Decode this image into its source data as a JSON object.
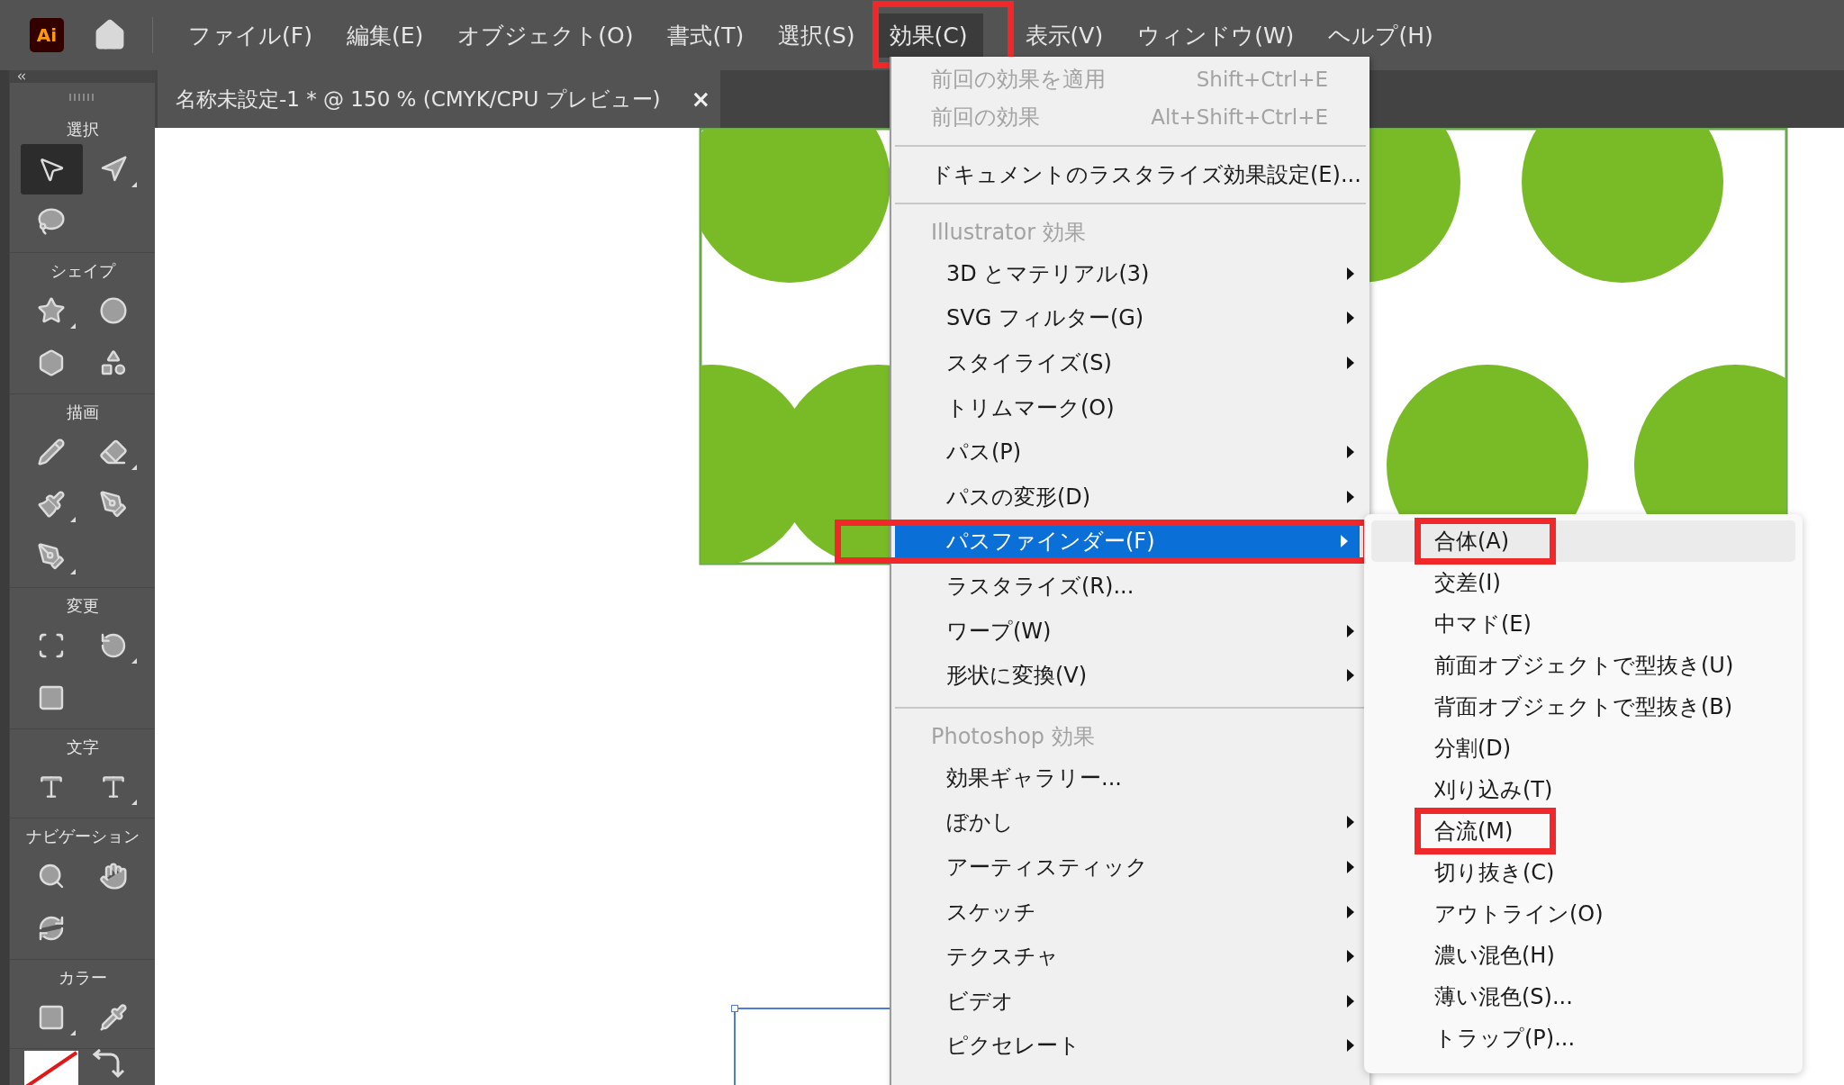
{
  "app": {
    "logo": "Ai"
  },
  "menu_bar": [
    {
      "label": "ファイル(F)",
      "selected": false,
      "marked": false
    },
    {
      "label": "編集(E)",
      "selected": false,
      "marked": false
    },
    {
      "label": "オブジェクト(O)",
      "selected": false,
      "marked": false
    },
    {
      "label": "書式(T)",
      "selected": false,
      "marked": false
    },
    {
      "label": "選択(S)",
      "selected": false,
      "marked": false
    },
    {
      "label": "効果(C)",
      "selected": true,
      "marked": true
    },
    {
      "label": "表示(V)",
      "selected": false,
      "marked": false
    },
    {
      "label": "ウィンドウ(W)",
      "selected": false,
      "marked": false
    },
    {
      "label": "ヘルプ(H)",
      "selected": false,
      "marked": false
    }
  ],
  "document_tab": {
    "title": "名称未設定-1 * @ 150 % (CMYK/CPU プレビュー)",
    "close": "×"
  },
  "toolbar": {
    "sections": [
      {
        "label": "選択",
        "tools": [
          {
            "selected": true,
            "flyout": false
          },
          {
            "selected": false,
            "flyout": true
          },
          {
            "selected": false,
            "flyout": false
          }
        ]
      },
      {
        "label": "シェイプ",
        "tools": [
          {
            "selected": false,
            "flyout": true
          },
          {
            "selected": false,
            "flyout": false
          },
          {
            "selected": false,
            "flyout": false
          },
          {
            "selected": false,
            "flyout": false
          }
        ]
      },
      {
        "label": "描画",
        "tools": [
          {
            "selected": false,
            "flyout": false
          },
          {
            "selected": false,
            "flyout": true
          },
          {
            "selected": false,
            "flyout": true
          },
          {
            "selected": false,
            "flyout": false
          },
          {
            "selected": false,
            "flyout": true
          }
        ]
      },
      {
        "label": "変更",
        "tools": [
          {
            "selected": false,
            "flyout": false
          },
          {
            "selected": false,
            "flyout": true
          },
          {
            "selected": false,
            "flyout": false
          }
        ]
      },
      {
        "label": "文字",
        "tools": [
          {
            "selected": false,
            "flyout": false
          },
          {
            "selected": false,
            "flyout": true
          }
        ]
      },
      {
        "label": "ナビゲーション",
        "tools": [
          {
            "selected": false,
            "flyout": false
          },
          {
            "selected": false,
            "flyout": false
          },
          {
            "selected": false,
            "flyout": false
          }
        ]
      },
      {
        "label": "カラー",
        "tools": [
          {
            "selected": false,
            "flyout": true
          },
          {
            "selected": false,
            "flyout": false
          }
        ]
      }
    ]
  },
  "effect_menu": {
    "items": [
      {
        "kind": "command",
        "label": "前回の効果を適用",
        "shortcut": "Shift+Ctrl+E",
        "disabled": true,
        "selected": false,
        "marked": false
      },
      {
        "kind": "command",
        "label": "前回の効果",
        "shortcut": "Alt+Shift+Ctrl+E",
        "disabled": true,
        "selected": false,
        "marked": false
      },
      {
        "kind": "separator"
      },
      {
        "kind": "command",
        "label": "ドキュメントのラスタライズ効果設定(E)...",
        "disabled": false,
        "selected": false,
        "marked": false
      },
      {
        "kind": "separator"
      },
      {
        "kind": "header",
        "label": "Illustrator 効果"
      },
      {
        "kind": "item",
        "label": "3D とマテリアル(3)",
        "submenu": true,
        "selected": false,
        "marked": false
      },
      {
        "kind": "item",
        "label": "SVG フィルター(G)",
        "submenu": true,
        "selected": false,
        "marked": false
      },
      {
        "kind": "item",
        "label": "スタイライズ(S)",
        "submenu": true,
        "selected": false,
        "marked": false
      },
      {
        "kind": "item",
        "label": "トリムマーク(O)",
        "submenu": false,
        "selected": false,
        "marked": false
      },
      {
        "kind": "item",
        "label": "パス(P)",
        "submenu": true,
        "selected": false,
        "marked": false
      },
      {
        "kind": "item",
        "label": "パスの変形(D)",
        "submenu": true,
        "selected": false,
        "marked": false
      },
      {
        "kind": "item",
        "label": "パスファインダー(F)",
        "submenu": true,
        "selected": true,
        "marked": true
      },
      {
        "kind": "item",
        "label": "ラスタライズ(R)...",
        "submenu": false,
        "selected": false,
        "marked": false
      },
      {
        "kind": "item",
        "label": "ワープ(W)",
        "submenu": true,
        "selected": false,
        "marked": false
      },
      {
        "kind": "item",
        "label": "形状に変換(V)",
        "submenu": true,
        "selected": false,
        "marked": false
      },
      {
        "kind": "separator"
      },
      {
        "kind": "header",
        "label": "Photoshop 効果"
      },
      {
        "kind": "item",
        "label": "効果ギャラリー...",
        "submenu": false,
        "selected": false,
        "marked": false
      },
      {
        "kind": "item",
        "label": "ぼかし",
        "submenu": true,
        "selected": false,
        "marked": false
      },
      {
        "kind": "item",
        "label": "アーティスティック",
        "submenu": true,
        "selected": false,
        "marked": false
      },
      {
        "kind": "item",
        "label": "スケッチ",
        "submenu": true,
        "selected": false,
        "marked": false
      },
      {
        "kind": "item",
        "label": "テクスチャ",
        "submenu": true,
        "selected": false,
        "marked": false
      },
      {
        "kind": "item",
        "label": "ビデオ",
        "submenu": true,
        "selected": false,
        "marked": false
      },
      {
        "kind": "item",
        "label": "ピクセレート",
        "submenu": true,
        "selected": false,
        "marked": false
      }
    ]
  },
  "pathfinder_submenu": {
    "items": [
      {
        "label": "合体(A)",
        "selected": true,
        "marked": true
      },
      {
        "label": "交差(I)",
        "selected": false,
        "marked": false
      },
      {
        "label": "中マド(E)",
        "selected": false,
        "marked": false
      },
      {
        "label": "前面オブジェクトで型抜き(U)",
        "selected": false,
        "marked": false
      },
      {
        "label": "背面オブジェクトで型抜き(B)",
        "selected": false,
        "marked": false
      },
      {
        "label": "分割(D)",
        "selected": false,
        "marked": false
      },
      {
        "label": "刈り込み(T)",
        "selected": false,
        "marked": false
      },
      {
        "label": "合流(M)",
        "selected": false,
        "marked": true
      },
      {
        "label": "切り抜き(C)",
        "selected": false,
        "marked": false
      },
      {
        "label": "アウトライン(O)",
        "selected": false,
        "marked": false
      },
      {
        "label": "濃い混色(H)",
        "selected": false,
        "marked": false
      },
      {
        "label": "薄い混色(S)...",
        "selected": false,
        "marked": false
      },
      {
        "label": "トラップ(P)...",
        "selected": false,
        "marked": false
      }
    ]
  }
}
